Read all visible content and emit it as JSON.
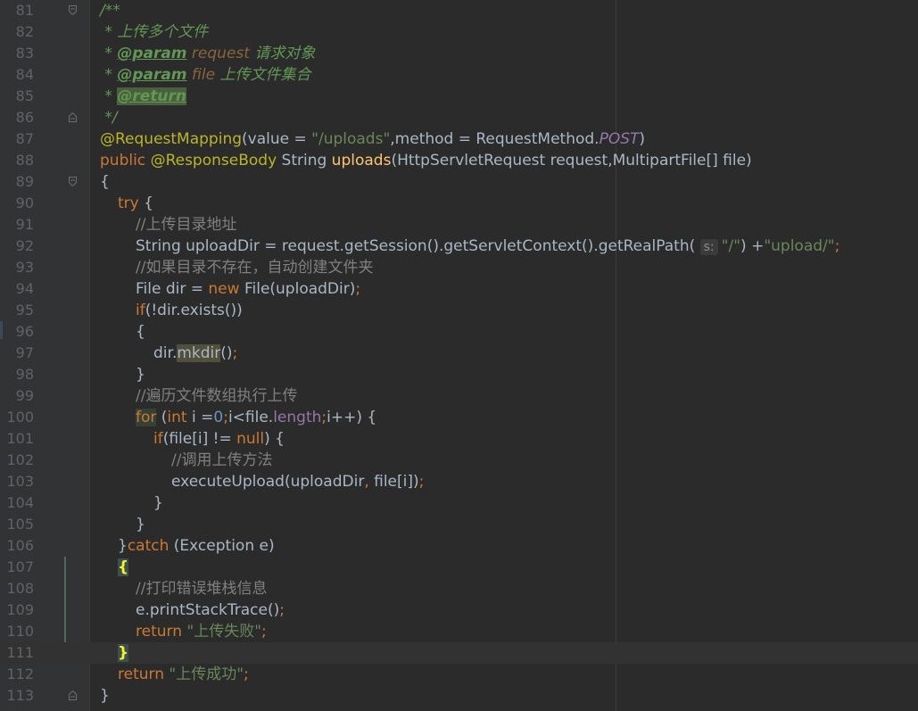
{
  "lines": [
    {
      "n": "81",
      "fold": "open",
      "indent": 0,
      "segs": [
        {
          "c": "doc",
          "t": "/**"
        }
      ]
    },
    {
      "n": "82",
      "indent": 0,
      "segs": [
        {
          "c": "doc",
          "t": " * 上传多个文件"
        }
      ]
    },
    {
      "n": "83",
      "indent": 0,
      "segs": [
        {
          "c": "doc",
          "t": " * "
        },
        {
          "c": "tag",
          "t": "@param"
        },
        {
          "c": "docparam",
          "t": " request"
        },
        {
          "c": "doc",
          "t": " 请求对象"
        }
      ]
    },
    {
      "n": "84",
      "indent": 0,
      "segs": [
        {
          "c": "doc",
          "t": " * "
        },
        {
          "c": "tag",
          "t": "@param"
        },
        {
          "c": "docparam",
          "t": " file"
        },
        {
          "c": "doc",
          "t": " 上传文件集合"
        }
      ]
    },
    {
      "n": "85",
      "indent": 0,
      "segs": [
        {
          "c": "doc",
          "t": " * "
        },
        {
          "c": "tag tagbg",
          "t": "@return"
        }
      ]
    },
    {
      "n": "86",
      "fold": "close",
      "indent": 0,
      "segs": [
        {
          "c": "doc",
          "t": " */"
        }
      ]
    },
    {
      "n": "87",
      "indent": 0,
      "segs": [
        {
          "c": "ann",
          "t": "@RequestMapping"
        },
        {
          "c": "",
          "t": "(value = "
        },
        {
          "c": "str",
          "t": "\"/uploads\""
        },
        {
          "c": "",
          "t": ",method = RequestMethod."
        },
        {
          "c": "const",
          "t": "POST"
        },
        {
          "c": "",
          "t": ")"
        }
      ]
    },
    {
      "n": "88",
      "indent": 0,
      "segs": [
        {
          "c": "kw",
          "t": "public "
        },
        {
          "c": "ann",
          "t": "@ResponseBody"
        },
        {
          "c": "",
          "t": " String "
        },
        {
          "c": "fn",
          "t": "uploads"
        },
        {
          "c": "",
          "t": "(HttpServletRequest request,MultipartFile[] file)"
        }
      ]
    },
    {
      "n": "89",
      "fold": "open",
      "indent": 0,
      "segs": [
        {
          "c": "",
          "t": "{"
        }
      ]
    },
    {
      "n": "90",
      "indent": 1,
      "segs": [
        {
          "c": "kw",
          "t": "try "
        },
        {
          "c": "",
          "t": "{"
        }
      ]
    },
    {
      "n": "91",
      "indent": 2,
      "segs": [
        {
          "c": "cmt",
          "t": "//上传目录地址"
        }
      ]
    },
    {
      "n": "92",
      "indent": 2,
      "segs": [
        {
          "c": "",
          "t": "String uploadDir = request.getSession().getServletContext().getRealPath( "
        },
        {
          "c": "hint",
          "t": "s:"
        },
        {
          "c": "str",
          "t": "\"/\""
        },
        {
          "c": "",
          "t": ") +"
        },
        {
          "c": "str",
          "t": "\"upload/\""
        },
        {
          "c": "kw",
          "t": ";"
        }
      ]
    },
    {
      "n": "93",
      "indent": 2,
      "segs": [
        {
          "c": "cmt",
          "t": "//如果目录不存在，自动创建文件夹"
        }
      ]
    },
    {
      "n": "94",
      "indent": 2,
      "segs": [
        {
          "c": "",
          "t": "File dir = "
        },
        {
          "c": "kw",
          "t": "new "
        },
        {
          "c": "",
          "t": "File(uploadDir)"
        },
        {
          "c": "kw",
          "t": ";"
        }
      ]
    },
    {
      "n": "95",
      "indent": 2,
      "segs": [
        {
          "c": "kw",
          "t": "if"
        },
        {
          "c": "",
          "t": "(!dir.exists())"
        }
      ]
    },
    {
      "n": "96",
      "indent": 2,
      "segs": [
        {
          "c": "",
          "t": "{"
        }
      ]
    },
    {
      "n": "97",
      "indent": 3,
      "segs": [
        {
          "c": "",
          "t": "dir."
        },
        {
          "c": "hlsel",
          "t": "mkdir"
        },
        {
          "c": "",
          "t": "()"
        },
        {
          "c": "kw",
          "t": ";"
        }
      ]
    },
    {
      "n": "98",
      "indent": 2,
      "segs": [
        {
          "c": "",
          "t": "}"
        }
      ]
    },
    {
      "n": "99",
      "indent": 2,
      "segs": [
        {
          "c": "cmt",
          "t": "//遍历文件数组执行上传"
        }
      ]
    },
    {
      "n": "100",
      "indent": 2,
      "segs": [
        {
          "c": "kw hl",
          "t": "for"
        },
        {
          "c": "",
          "t": " ("
        },
        {
          "c": "kw",
          "t": "int "
        },
        {
          "c": "",
          "t": "i ="
        },
        {
          "c": "num",
          "t": "0"
        },
        {
          "c": "kw",
          "t": ";"
        },
        {
          "c": "",
          "t": "i<file."
        },
        {
          "c": "field",
          "t": "length"
        },
        {
          "c": "kw",
          "t": ";"
        },
        {
          "c": "",
          "t": "i++) {"
        }
      ]
    },
    {
      "n": "101",
      "indent": 3,
      "segs": [
        {
          "c": "kw",
          "t": "if"
        },
        {
          "c": "",
          "t": "(file[i] != "
        },
        {
          "c": "kw",
          "t": "null"
        },
        {
          "c": "",
          "t": ") {"
        }
      ]
    },
    {
      "n": "102",
      "indent": 4,
      "segs": [
        {
          "c": "cmt",
          "t": "//调用上传方法"
        }
      ]
    },
    {
      "n": "103",
      "indent": 4,
      "segs": [
        {
          "c": "",
          "t": "executeUpload(uploadDir"
        },
        {
          "c": "kw",
          "t": ", "
        },
        {
          "c": "",
          "t": "file[i])"
        },
        {
          "c": "kw",
          "t": ";"
        }
      ]
    },
    {
      "n": "104",
      "indent": 3,
      "segs": [
        {
          "c": "",
          "t": "}"
        }
      ]
    },
    {
      "n": "105",
      "indent": 2,
      "segs": [
        {
          "c": "",
          "t": "}"
        }
      ]
    },
    {
      "n": "106",
      "indent": 1,
      "segs": [
        {
          "c": "",
          "t": "}"
        },
        {
          "c": "kw",
          "t": "catch "
        },
        {
          "c": "",
          "t": "(Exception e)"
        }
      ]
    },
    {
      "n": "107",
      "indent": 1,
      "segs": [
        {
          "c": "brace",
          "t": "{"
        }
      ]
    },
    {
      "n": "108",
      "indent": 2,
      "segs": [
        {
          "c": "cmt",
          "t": "//打印错误堆栈信息"
        }
      ]
    },
    {
      "n": "109",
      "indent": 2,
      "segs": [
        {
          "c": "",
          "t": "e.printStackTrace()"
        },
        {
          "c": "kw",
          "t": ";"
        }
      ]
    },
    {
      "n": "110",
      "indent": 2,
      "segs": [
        {
          "c": "kw",
          "t": "return "
        },
        {
          "c": "str",
          "t": "\"上传失败\""
        },
        {
          "c": "kw",
          "t": ";"
        }
      ]
    },
    {
      "n": "111",
      "indent": 1,
      "current": true,
      "segs": [
        {
          "c": "brace",
          "t": "}"
        }
      ]
    },
    {
      "n": "112",
      "indent": 1,
      "segs": [
        {
          "c": "kw",
          "t": "return "
        },
        {
          "c": "str",
          "t": "\"上传成功\""
        },
        {
          "c": "kw",
          "t": ";"
        }
      ]
    },
    {
      "n": "113",
      "fold": "close",
      "indent": 0,
      "segs": [
        {
          "c": "",
          "t": "}"
        }
      ]
    }
  ]
}
